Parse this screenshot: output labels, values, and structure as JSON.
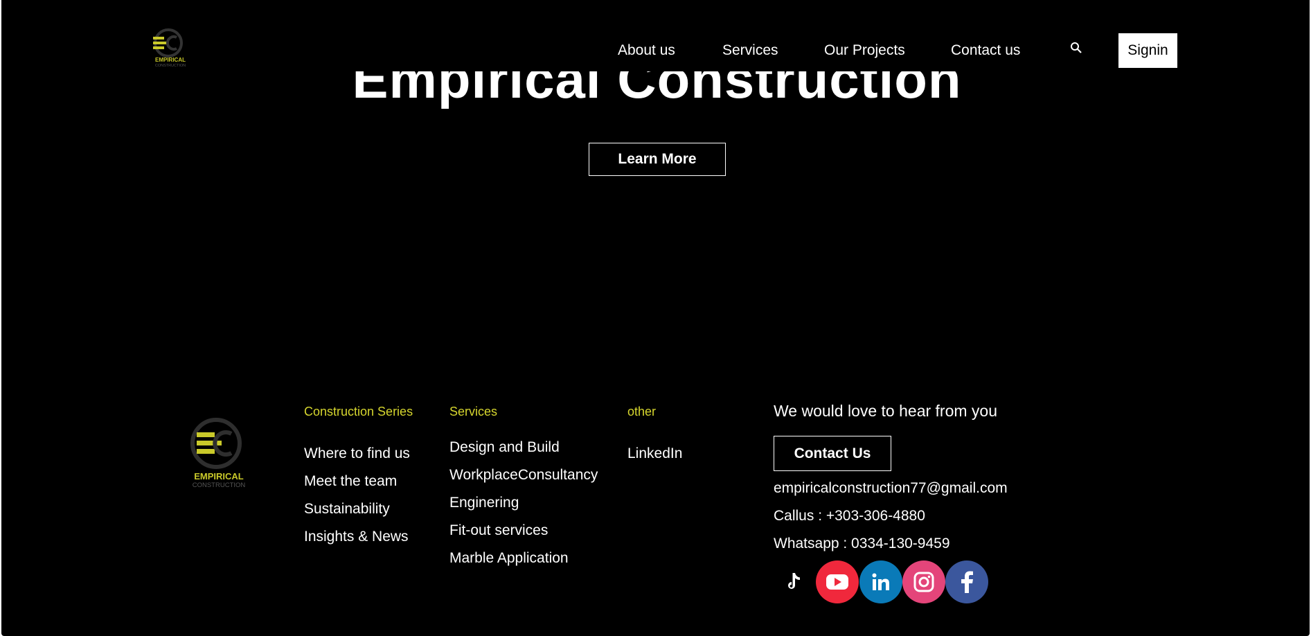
{
  "header": {
    "logo_alt": "Empirical Construction logo",
    "nav": [
      "About us",
      "Services",
      "Our Projects",
      "Contact us"
    ],
    "signin_label": "Signin"
  },
  "hero": {
    "title": "Empirical Construction",
    "learn_more_label": "Learn More"
  },
  "footer": {
    "logo_text_top": "EMPIRICAL",
    "logo_text_bottom": "CONSTRUCTION",
    "columns": [
      {
        "heading": "Construction Series",
        "links": [
          "Where to find us",
          "Meet the team",
          "Sustainability",
          "Insights & News"
        ]
      },
      {
        "heading": "Services",
        "links": [
          "Design and Build",
          "WorkplaceConsultancy",
          "Enginering",
          "Fit-out services",
          "Marble Application"
        ]
      },
      {
        "heading": "other",
        "links": [
          "LinkedIn"
        ]
      }
    ],
    "contact": {
      "heading": "We would love to hear from you",
      "button_label": "Contact Us",
      "email": "empiricalconstruction77@gmail.com",
      "call": "Callus : +303-306-4880",
      "whatsapp": "Whatsapp : 0334-130-9459"
    },
    "social": [
      {
        "name": "tiktok-icon",
        "color": "#000000"
      },
      {
        "name": "youtube-icon",
        "color": "#f0283c"
      },
      {
        "name": "linkedin-icon",
        "color": "#0a7ab8"
      },
      {
        "name": "instagram-icon",
        "color": "#e4457a"
      },
      {
        "name": "facebook-icon",
        "color": "#3b579d"
      }
    ]
  },
  "colors": {
    "accent": "#d6d62e",
    "background": "#000000"
  }
}
